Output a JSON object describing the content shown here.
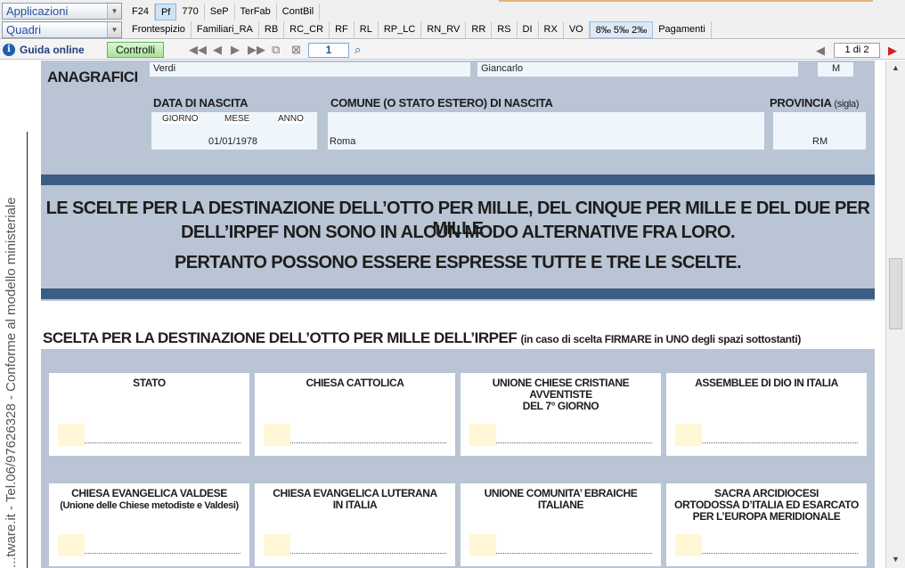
{
  "toolbar": {
    "apps_label": "Applicazioni",
    "quadri_label": "Quadri",
    "tabs_top": [
      {
        "label": "F24"
      },
      {
        "label": "Pf",
        "active": true
      },
      {
        "label": "770"
      },
      {
        "label": "SeP"
      },
      {
        "label": "TerFab"
      },
      {
        "label": "ContBil"
      }
    ],
    "tabs_bottom": [
      {
        "label": "Frontespizio"
      },
      {
        "label": "Familiari_RA"
      },
      {
        "label": "RB"
      },
      {
        "label": "RC_CR"
      },
      {
        "label": "RF"
      },
      {
        "label": "RL"
      },
      {
        "label": "RP_LC"
      },
      {
        "label": "RN_RV"
      },
      {
        "label": "RR"
      },
      {
        "label": "RS"
      },
      {
        "label": "DI"
      },
      {
        "label": "RX"
      },
      {
        "label": "VO"
      },
      {
        "label": "8‰ 5‰ 2‰",
        "shaded": true
      },
      {
        "label": "Pagamenti"
      }
    ]
  },
  "navbar": {
    "guida_label": "Guida online",
    "controlli_label": "Controlli",
    "page_input": "1",
    "page_count": "1 di 2"
  },
  "sidebar": {
    "vertical_text": "...tware.it - Tel.06/97626328 - Conforme al modello ministeriale"
  },
  "anagrafici": {
    "title": "ANAGRAFICI",
    "cognome": "Verdi",
    "nome": "Giancarlo",
    "sesso": "M",
    "data_nascita_label": "DATA DI NASCITA",
    "giorno_label": "GIORNO",
    "mese_label": "MESE",
    "anno_label": "ANNO",
    "data_nascita": "01/01/1978",
    "comune_label": "COMUNE (O STATO ESTERO) DI NASCITA",
    "comune": "Roma",
    "provincia_label": "PROVINCIA",
    "provincia_sigla": "(sigla)",
    "provincia": "RM"
  },
  "banner": {
    "line1": "LE SCELTE PER LA DESTINAZIONE DELL’OTTO PER MILLE, DEL CINQUE PER MILLE E DEL DUE PER MILLE",
    "line2": "DELL’IRPEF NON SONO IN ALCUN MODO ALTERNATIVE FRA LORO.",
    "line3": "PERTANTO POSSONO ESSERE ESPRESSE TUTTE E TRE LE SCELTE."
  },
  "scelta": {
    "title": "SCELTA PER LA DESTINAZIONE DELL’OTTO PER MILLE DELL’IRPEF",
    "subtitle": "(in caso di scelta FIRMARE in UNO degli spazi sottostanti)",
    "cards": [
      {
        "line1": "STATO",
        "line2": ""
      },
      {
        "line1": "CHIESA CATTOLICA",
        "line2": ""
      },
      {
        "line1": "UNIONE CHIESE CRISTIANE AVVENTISTE",
        "line2": "DEL 7° GIORNO"
      },
      {
        "line1": "ASSEMBLEE DI DIO IN ITALIA",
        "line2": ""
      },
      {
        "line1": "CHIESA EVANGELICA VALDESE",
        "line2": "(Unione delle Chiese metodiste e Valdesi)"
      },
      {
        "line1": "CHIESA EVANGELICA LUTERANA",
        "line2": "IN ITALIA"
      },
      {
        "line1": "UNIONE COMUNITA’ EBRAICHE",
        "line2": "ITALIANE"
      },
      {
        "line1": "SACRA ARCIDIOCESI",
        "line2": "ORTODOSSA D’ITALIA ED ESARCATO PER L’EUROPA MERIDIONALE"
      }
    ]
  }
}
